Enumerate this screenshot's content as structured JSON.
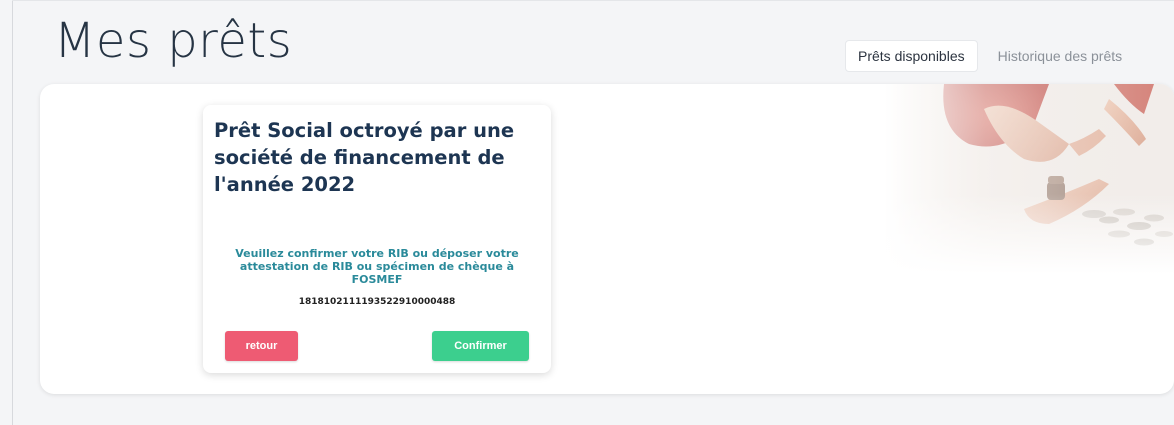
{
  "page": {
    "title": "Mes prêts"
  },
  "tabs": [
    {
      "label": "Prêts disponibles",
      "active": true
    },
    {
      "label": "Historique des prêts",
      "active": false
    }
  ],
  "loan_card": {
    "title": "Prêt Social octroyé par une société de financement de l'année 2022",
    "instruction": "Veuillez confirmer votre RIB ou déposer votre attestation de RIB ou spécimen de chèque à FOSMEF",
    "rib": "1818102111193522910000488",
    "back_label": "retour",
    "confirm_label": "Confirmer"
  },
  "colors": {
    "title_text": "#263444",
    "card_title": "#1d3552",
    "instruction_text": "#2a8a9a",
    "back_button": "#ee5b73",
    "confirm_button": "#3ccf8e",
    "background": "#f4f5f7"
  },
  "hero_image": {
    "icon": "hands-with-coins-photo"
  }
}
